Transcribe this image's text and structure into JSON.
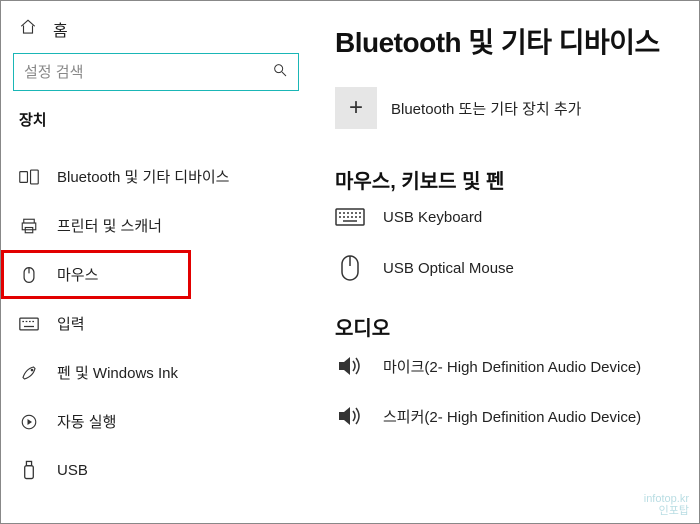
{
  "sidebar": {
    "home_label": "홈",
    "search_placeholder": "설정 검색",
    "category_label": "장치",
    "items": [
      {
        "label": "Bluetooth 및 기타 디바이스",
        "icon": "bluetooth-devices-icon"
      },
      {
        "label": "프린터 및 스캐너",
        "icon": "printer-icon"
      },
      {
        "label": "마우스",
        "icon": "mouse-icon"
      },
      {
        "label": "입력",
        "icon": "keyboard-icon"
      },
      {
        "label": "펜 및 Windows Ink",
        "icon": "pen-icon"
      },
      {
        "label": "자동 실행",
        "icon": "autoplay-icon"
      },
      {
        "label": "USB",
        "icon": "usb-icon"
      }
    ]
  },
  "content": {
    "title": "Bluetooth 및 기타 디바이스",
    "add_device_label": "Bluetooth 또는 기타 장치 추가",
    "sections": [
      {
        "heading": "마우스, 키보드 및 펜",
        "devices": [
          {
            "name": "USB Keyboard",
            "icon": "keyboard-device-icon"
          },
          {
            "name": "USB Optical Mouse",
            "icon": "mouse-device-icon"
          }
        ]
      },
      {
        "heading": "오디오",
        "devices": [
          {
            "name": "마이크(2- High Definition Audio Device)",
            "icon": "speaker-icon"
          },
          {
            "name": "스피커(2- High Definition Audio Device)",
            "icon": "speaker-icon"
          }
        ]
      }
    ]
  },
  "watermark": {
    "line1": "infotop.kr",
    "line2": "인포탑"
  }
}
